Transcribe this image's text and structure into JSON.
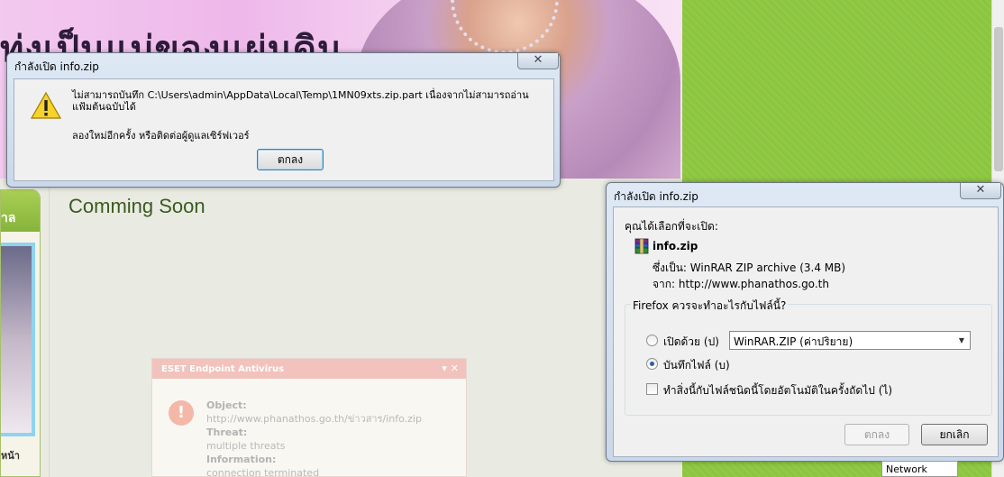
{
  "background": {
    "banner_text": "ทุ่งเป็นแม่ของแผ่นดิน",
    "left_panel_header": "าล",
    "left_caption": "หน้า",
    "main_heading": "Comming Soon"
  },
  "eset": {
    "title": "ESET Endpoint Antivirus",
    "icon": "!",
    "object_label": "Object:",
    "object_value": "http://www.phanathos.go.th/ข่าวสาร/info.zip",
    "threat_label": "Threat:",
    "threat_value": "multiple threats",
    "information_label": "Information:",
    "information_value": "connection terminated",
    "controls": "▾ ✕"
  },
  "error_dialog": {
    "title": "กำลังเปิด info.zip",
    "close": "✕",
    "message": "ไม่สามารถบันทึก C:\\Users\\admin\\AppData\\Local\\Temp\\1MN09xts.zip.part เนื่องจากไม่สามารถอ่านแฟ้มต้นฉบับได้",
    "hint": "ลองใหม่อีกครั้ง หรือติดต่อผู้ดูแลเซิร์ฟเวอร์",
    "ok_label": "ตกลง"
  },
  "open_dialog": {
    "title": "กำลังเปิด info.zip",
    "close": "✕",
    "chosen_label": "คุณได้เลือกที่จะเปิด:",
    "file_name": "info.zip",
    "file_type": "ซึ่งเป็น: WinRAR ZIP archive (3.4 MB)",
    "file_from": "จาก: http://www.phanathos.go.th",
    "question": "Firefox ควรจะทำอะไรกับไฟล์นี้?",
    "open_with_label": "เปิดด้วย (ป)",
    "open_with_app": "WinRAR.ZIP (ค่าปริยาย)",
    "save_label": "บันทึกไฟล์ (บ)",
    "save_selected": true,
    "remember_label": "ทำสิ่งนี้กับไฟล์ชนิดนี้โดยอัตโนมัติในครั้งถัดไป (ไ)",
    "ok_label": "ตกลง",
    "cancel_label": "ยกเลิก"
  },
  "taskbar_tip": "Network",
  "colors": {
    "page_green": "#8cc63f",
    "banner_pink": "#eeb8ea",
    "heading_green": "#3b5a1f",
    "eset_header": "#f1c3bc",
    "dialog_frame": "#c9d8ea"
  }
}
